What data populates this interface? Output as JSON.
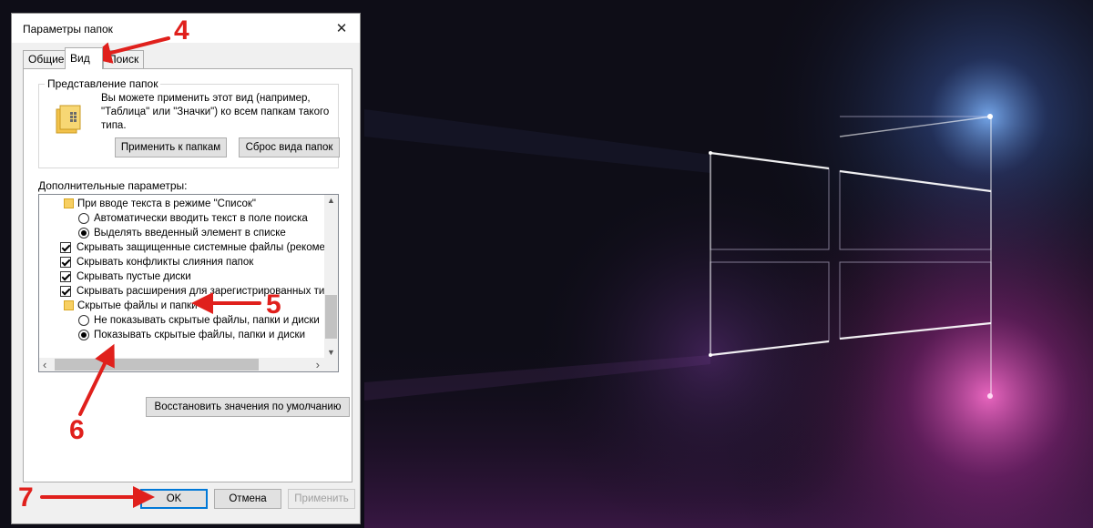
{
  "dialog": {
    "title": "Параметры папок",
    "close_glyph": "✕",
    "tabs": [
      {
        "label": "Общие"
      },
      {
        "label": "Вид"
      },
      {
        "label": "Поиск"
      }
    ],
    "active_tab": "Вид",
    "folder_view": {
      "group_title": "Представление папок",
      "description": "Вы можете применить этот вид (например, \"Таблица\" или \"Значки\") ко всем папкам такого типа.",
      "apply_button": "Применить к папкам",
      "reset_button": "Сброс вида папок"
    },
    "advanced": {
      "label": "Дополнительные параметры:",
      "items": [
        {
          "type": "folder",
          "text": "При вводе текста в режиме \"Список\""
        },
        {
          "type": "radio",
          "checked": false,
          "text": "Автоматически вводить текст в поле поиска"
        },
        {
          "type": "radio",
          "checked": true,
          "text": "Выделять введенный элемент в списке"
        },
        {
          "type": "checkbox",
          "checked": true,
          "text": "Скрывать защищенные системные файлы (рекомен,"
        },
        {
          "type": "checkbox",
          "checked": true,
          "text": "Скрывать конфликты слияния папок"
        },
        {
          "type": "checkbox",
          "checked": true,
          "text": "Скрывать пустые диски"
        },
        {
          "type": "checkbox",
          "checked": true,
          "text": "Скрывать расширения для зарегистрированных типо"
        },
        {
          "type": "folder",
          "text": "Скрытые файлы и папки"
        },
        {
          "type": "radio",
          "checked": false,
          "text": "Не показывать скрытые файлы, папки и диски"
        },
        {
          "type": "radio",
          "checked": true,
          "text": "Показывать скрытые файлы, папки и диски"
        }
      ],
      "restore_button": "Восстановить значения по умолчанию"
    },
    "buttons": {
      "ok": "OK",
      "cancel": "Отмена",
      "apply": "Применить"
    }
  },
  "annotations": {
    "step4": "4",
    "step5": "5",
    "step6": "6",
    "step7": "7",
    "color": "#e0201c"
  },
  "icons": {
    "close": "close-icon",
    "folder": "folder-icon",
    "scroll_up": "▲",
    "scroll_down": "▼",
    "scroll_left": "‹",
    "scroll_right": "›"
  }
}
